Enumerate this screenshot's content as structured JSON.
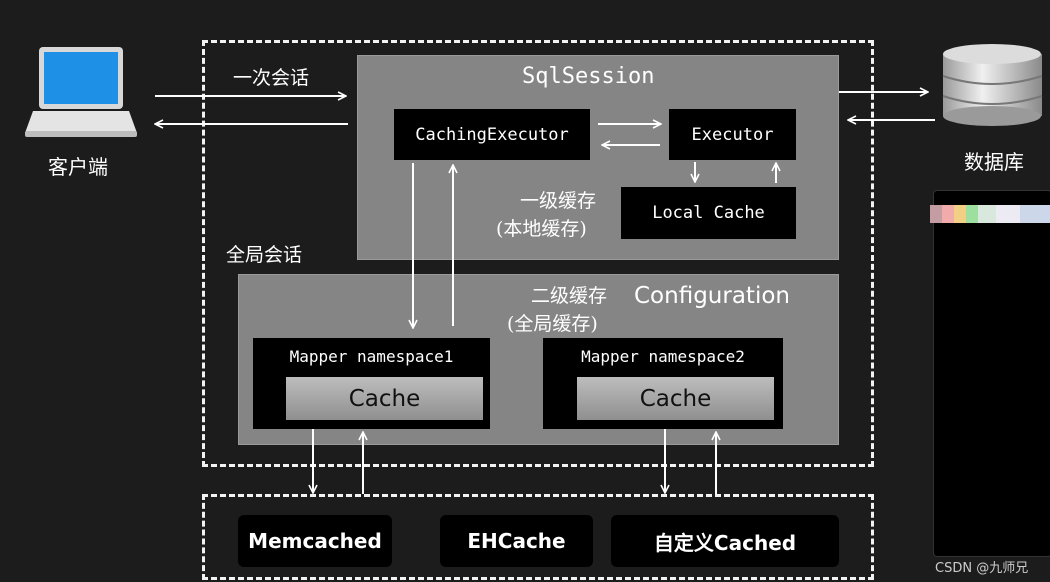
{
  "client": {
    "label": "客户端",
    "icon": "laptop-icon"
  },
  "database": {
    "label": "数据库",
    "icon": "database-icon"
  },
  "session_label": "一次会话",
  "global_label": "全局会话",
  "sql_session": {
    "title": "SqlSession",
    "caching_executor": "CachingExecutor",
    "executor": "Executor",
    "local_cache": "Local Cache",
    "first_level_line1": "一级缓存",
    "first_level_line2": "(本地缓存)"
  },
  "configuration": {
    "title": "Configuration",
    "second_level_line1": "二级缓存",
    "second_level_line2": "(全局缓存)",
    "mappers": [
      {
        "name": "Mapper namespace1",
        "cache": "Cache"
      },
      {
        "name": "Mapper namespace2",
        "cache": "Cache"
      }
    ]
  },
  "stores": [
    "Memcached",
    "EHCache",
    "自定义Cached"
  ],
  "watermark": "CSDN @九师兄"
}
